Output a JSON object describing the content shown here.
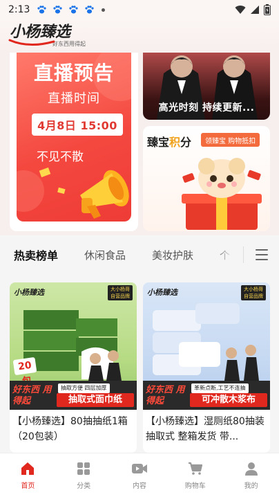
{
  "status_bar": {
    "time": "2:13"
  },
  "header": {
    "logo_text": "小杨臻选",
    "logo_sub": "好东西用得起"
  },
  "banners": {
    "live": {
      "title": "直播预告",
      "time_label": "直播时间",
      "date": "4月8日 15:00",
      "slogan": "不见不散"
    },
    "highlight": {
      "text": "高光时刻 持续更新..."
    },
    "points": {
      "title_a": "臻宝",
      "title_b": "积",
      "title_c": "分",
      "badge": "领臻宝 购物抵扣"
    }
  },
  "tabs": [
    {
      "label": "热卖榜单"
    },
    {
      "label": "休闲食品"
    },
    {
      "label": "美妆护肤"
    },
    {
      "label": "个"
    }
  ],
  "products": [
    {
      "brand": "小杨臻选",
      "brand_tag": "大小杨哥 自营品牌",
      "badge": "20包",
      "slogan": "好东西 用得起",
      "tagline": "抽取方便 四层加厚",
      "name": "抽取式面巾纸",
      "title": "【小杨臻选】80抽抽纸1箱（20包装）"
    },
    {
      "brand": "小杨臻选",
      "brand_tag": "大小杨哥 自营品牌",
      "slogan": "好东西 用得起",
      "tagline": "革新点断,工艺不连抽",
      "name": "可冲散木浆布",
      "title": "【小杨臻选】湿厕纸80抽装抽取式 整箱发货 带..."
    }
  ],
  "bottom_nav": [
    {
      "label": "首页",
      "icon": "home-icon",
      "active": true
    },
    {
      "label": "分类",
      "icon": "category-icon",
      "active": false
    },
    {
      "label": "内容",
      "icon": "video-icon",
      "active": false
    },
    {
      "label": "购物车",
      "icon": "cart-icon",
      "active": false
    },
    {
      "label": "我的",
      "icon": "profile-icon",
      "active": false
    }
  ],
  "colors": {
    "accent": "#e0281f",
    "live_bg": "#f4483f",
    "gold": "#f0a21c"
  }
}
